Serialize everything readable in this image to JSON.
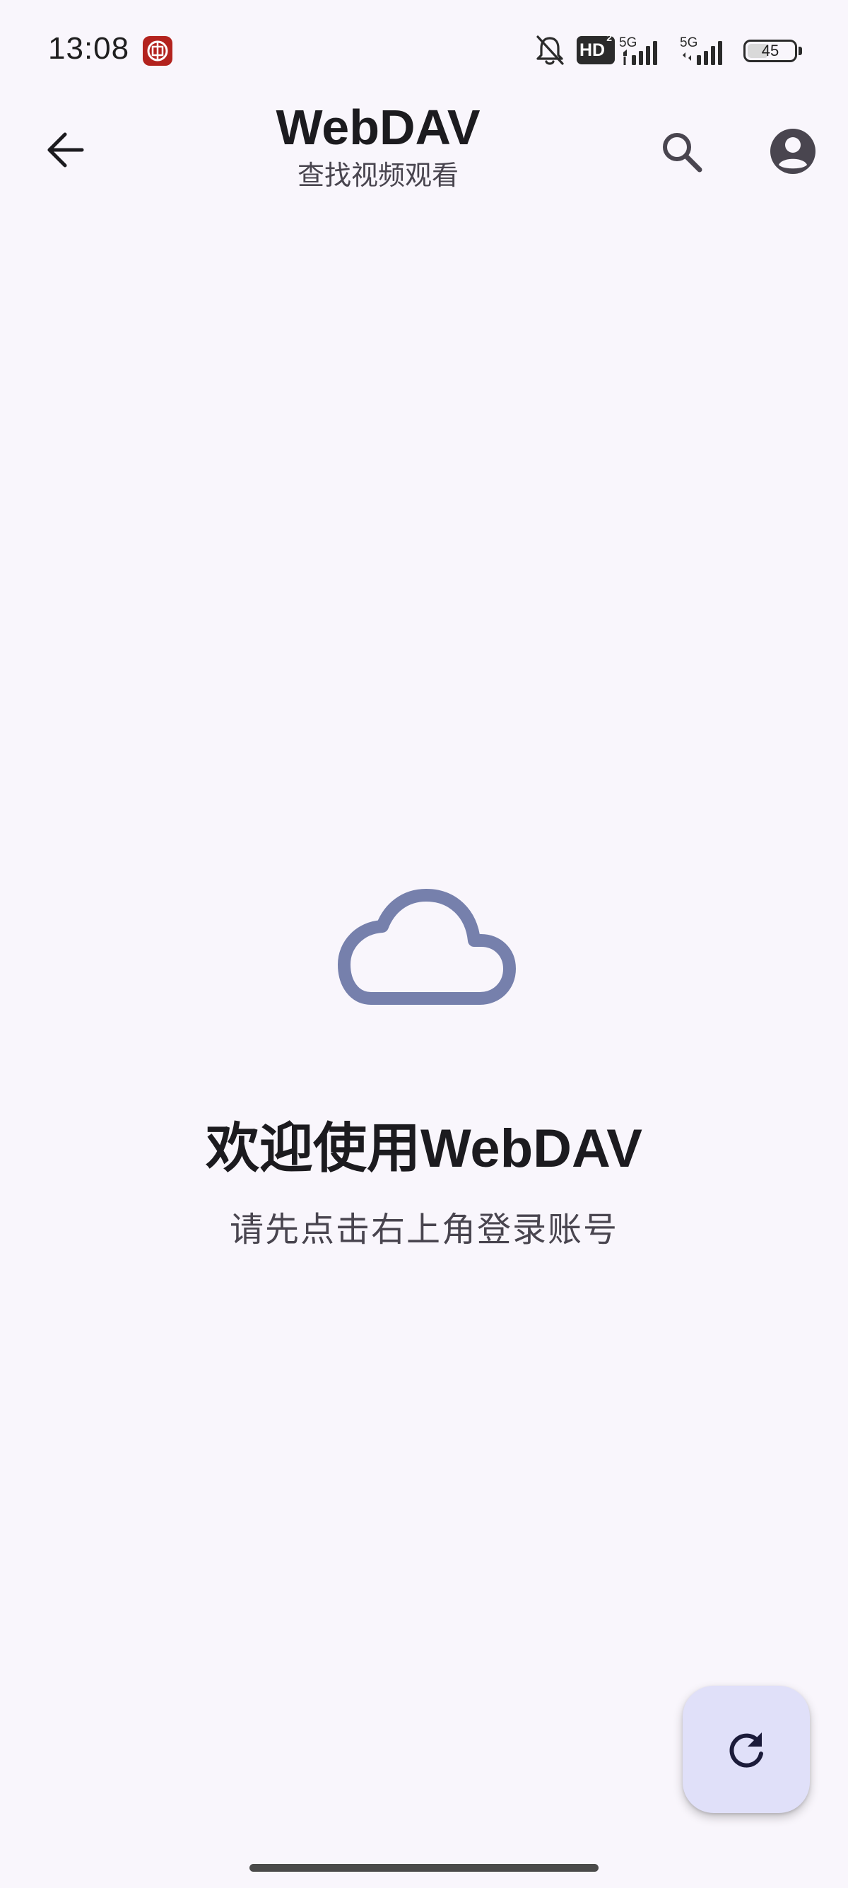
{
  "status_bar": {
    "time": "13:08",
    "app_badge_icon": "bank-app-icon",
    "notification_icon": "bell-off-icon",
    "hd_label": "HD",
    "hd_sub": "2",
    "sim1_label": "5G",
    "sim2_label": "5G",
    "battery_percent": "45",
    "battery_level": 0.45
  },
  "app_bar": {
    "back_icon": "arrow-left-icon",
    "title": "WebDAV",
    "subtitle": "查找视频观看",
    "search_icon": "search-icon",
    "account_icon": "account-circle-icon"
  },
  "empty_state": {
    "icon": "cloud-icon",
    "icon_color": "#7680ac",
    "title": "欢迎使用WebDAV",
    "hint": "请先点击右上角登录账号"
  },
  "fab": {
    "icon": "refresh-icon",
    "background": "#e0e0f9",
    "icon_color": "#1b1b3a"
  },
  "colors": {
    "background": "#f9f6fc",
    "text_primary": "#1c1b1f",
    "text_secondary": "#49454f"
  }
}
